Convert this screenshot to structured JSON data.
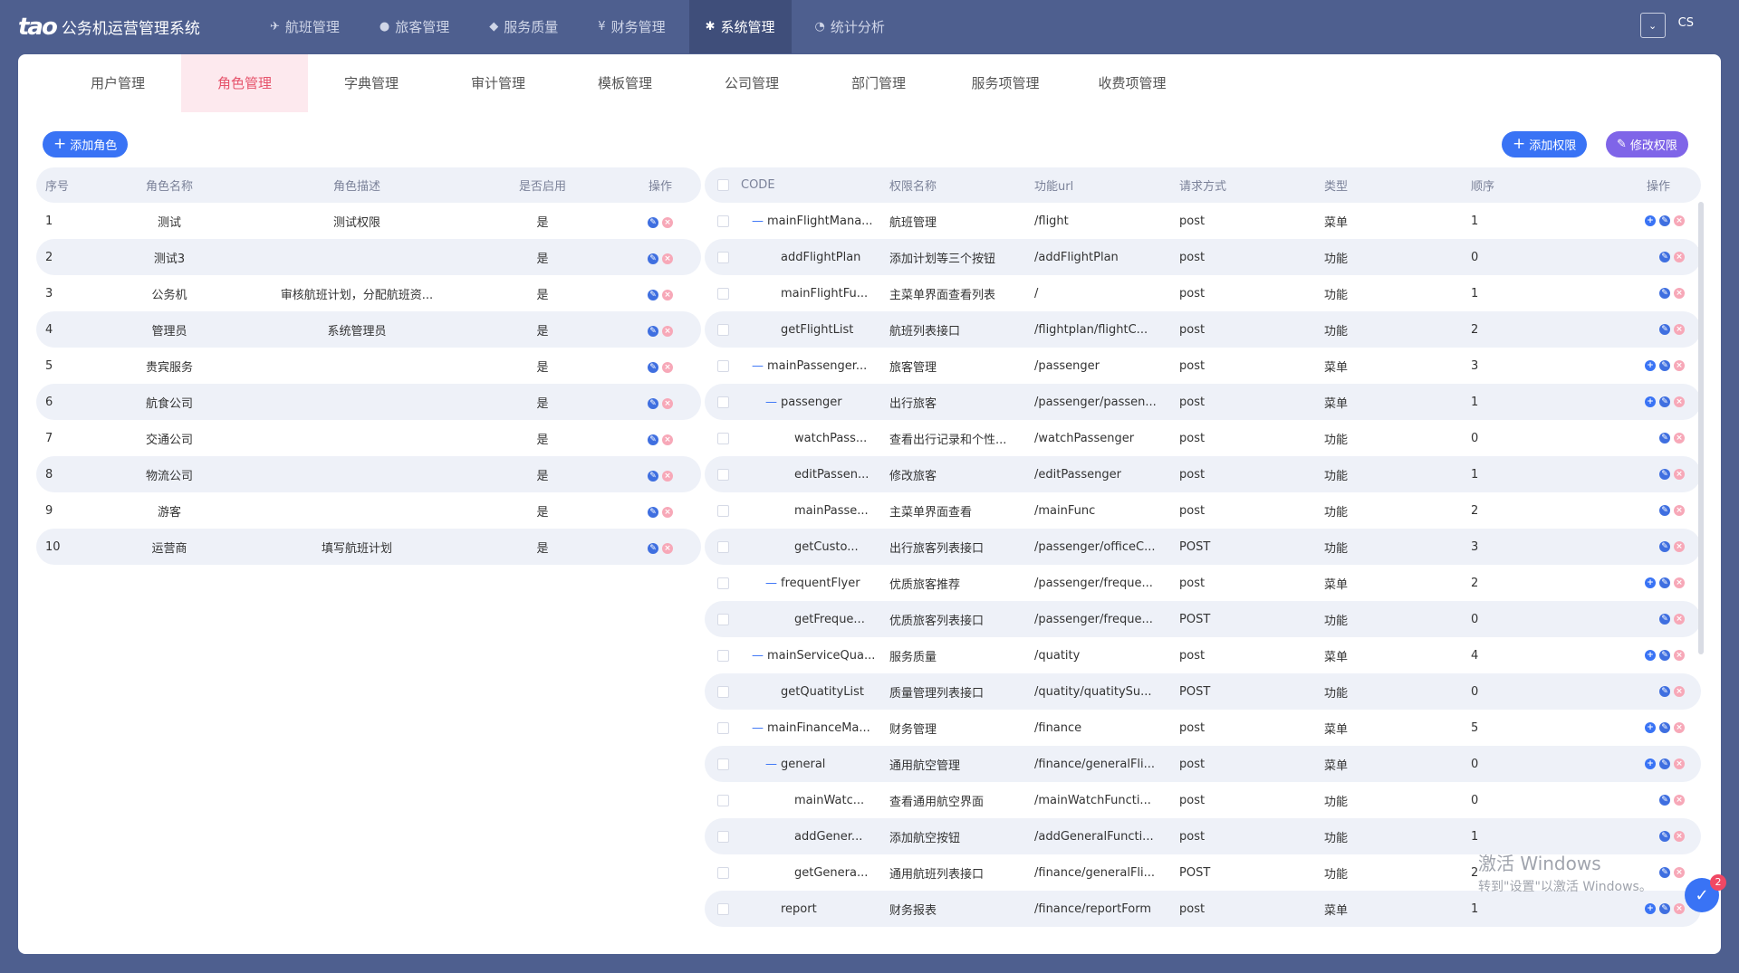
{
  "app": {
    "logo_text": "tao",
    "title": "公务机运营管理系统"
  },
  "nav": [
    {
      "label": "航班管理",
      "icon": "plane-icon"
    },
    {
      "label": "旅客管理",
      "icon": "user-icon"
    },
    {
      "label": "服务质量",
      "icon": "shield-icon"
    },
    {
      "label": "财务管理",
      "icon": "money-icon"
    },
    {
      "label": "系统管理",
      "icon": "gear-icon",
      "active": true
    },
    {
      "label": "统计分析",
      "icon": "pie-chart-icon"
    }
  ],
  "user": {
    "toggle": "⌄",
    "name": "CS"
  },
  "subtabs": [
    {
      "label": "用户管理"
    },
    {
      "label": "角色管理",
      "active": true
    },
    {
      "label": "字典管理"
    },
    {
      "label": "审计管理"
    },
    {
      "label": "模板管理"
    },
    {
      "label": "公司管理"
    },
    {
      "label": "部门管理"
    },
    {
      "label": "服务项管理"
    },
    {
      "label": "收费项管理"
    }
  ],
  "buttons": {
    "add_role": "添加角色",
    "add_perm": "添加权限",
    "edit_perm": "修改权限"
  },
  "roles": {
    "headers": {
      "seq": "序号",
      "name": "角色名称",
      "desc": "角色描述",
      "enabled": "是否启用",
      "op": "操作"
    },
    "rows": [
      {
        "seq": "1",
        "name": "测试",
        "desc": "测试权限",
        "enabled": "是"
      },
      {
        "seq": "2",
        "name": "测试3",
        "desc": "",
        "enabled": "是"
      },
      {
        "seq": "3",
        "name": "公务机",
        "desc": "审核航班计划，分配航班资...",
        "enabled": "是"
      },
      {
        "seq": "4",
        "name": "管理员",
        "desc": "系统管理员",
        "enabled": "是"
      },
      {
        "seq": "5",
        "name": "贵宾服务",
        "desc": "",
        "enabled": "是"
      },
      {
        "seq": "6",
        "name": "航食公司",
        "desc": "",
        "enabled": "是"
      },
      {
        "seq": "7",
        "name": "交通公司",
        "desc": "",
        "enabled": "是"
      },
      {
        "seq": "8",
        "name": "物流公司",
        "desc": "",
        "enabled": "是"
      },
      {
        "seq": "9",
        "name": "游客",
        "desc": "",
        "enabled": "是"
      },
      {
        "seq": "10",
        "name": "运营商",
        "desc": "填写航班计划",
        "enabled": "是"
      }
    ]
  },
  "perms": {
    "headers": {
      "code": "CODE",
      "name": "权限名称",
      "url": "功能url",
      "method": "请求方式",
      "type": "类型",
      "order": "顺序",
      "op": "操作"
    },
    "rows": [
      {
        "level": 0,
        "expander": "—",
        "code": "mainFlightMana...",
        "name": "航班管理",
        "url": "/flight",
        "method": "post",
        "type": "菜单",
        "order": "1",
        "add": true
      },
      {
        "level": 1,
        "expander": "",
        "code": "addFlightPlan",
        "name": "添加计划等三个按钮",
        "url": "/addFlightPlan",
        "method": "post",
        "type": "功能",
        "order": "0",
        "add": false
      },
      {
        "level": 1,
        "expander": "",
        "code": "mainFlightFu...",
        "name": "主菜单界面查看列表",
        "url": "/",
        "method": "post",
        "type": "功能",
        "order": "1",
        "add": false
      },
      {
        "level": 1,
        "expander": "",
        "code": "getFlightList",
        "name": "航班列表接口",
        "url": "/flightplan/flightC...",
        "method": "post",
        "type": "功能",
        "order": "2",
        "add": false
      },
      {
        "level": 0,
        "expander": "—",
        "code": "mainPassenger...",
        "name": "旅客管理",
        "url": "/passenger",
        "method": "post",
        "type": "菜单",
        "order": "3",
        "add": true
      },
      {
        "level": 1,
        "expander": "—",
        "code": "passenger",
        "name": "出行旅客",
        "url": "/passenger/passen...",
        "method": "post",
        "type": "菜单",
        "order": "1",
        "add": true
      },
      {
        "level": 2,
        "expander": "",
        "code": "watchPass...",
        "name": "查看出行记录和个性...",
        "url": "/watchPassenger",
        "method": "post",
        "type": "功能",
        "order": "0",
        "add": false
      },
      {
        "level": 2,
        "expander": "",
        "code": "editPassen...",
        "name": "修改旅客",
        "url": "/editPassenger",
        "method": "post",
        "type": "功能",
        "order": "1",
        "add": false
      },
      {
        "level": 2,
        "expander": "",
        "code": "mainPasse...",
        "name": "主菜单界面查看",
        "url": "/mainFunc",
        "method": "post",
        "type": "功能",
        "order": "2",
        "add": false
      },
      {
        "level": 2,
        "expander": "",
        "code": "getCusto...",
        "name": "出行旅客列表接口",
        "url": "/passenger/officeC...",
        "method": "POST",
        "type": "功能",
        "order": "3",
        "add": false
      },
      {
        "level": 1,
        "expander": "—",
        "code": "frequentFlyer",
        "name": "优质旅客推荐",
        "url": "/passenger/freque...",
        "method": "post",
        "type": "菜单",
        "order": "2",
        "add": true
      },
      {
        "level": 2,
        "expander": "",
        "code": "getFreque...",
        "name": "优质旅客列表接口",
        "url": "/passenger/freque...",
        "method": "POST",
        "type": "功能",
        "order": "0",
        "add": false
      },
      {
        "level": 0,
        "expander": "—",
        "code": "mainServiceQua...",
        "name": "服务质量",
        "url": "/quatity",
        "method": "post",
        "type": "菜单",
        "order": "4",
        "add": true
      },
      {
        "level": 1,
        "expander": "",
        "code": "getQuatityList",
        "name": "质量管理列表接口",
        "url": "/quatity/quatitySu...",
        "method": "POST",
        "type": "功能",
        "order": "0",
        "add": false
      },
      {
        "level": 0,
        "expander": "—",
        "code": "mainFinanceMa...",
        "name": "财务管理",
        "url": "/finance",
        "method": "post",
        "type": "菜单",
        "order": "5",
        "add": true
      },
      {
        "level": 1,
        "expander": "—",
        "code": "general",
        "name": "通用航空管理",
        "url": "/finance/generalFli...",
        "method": "post",
        "type": "菜单",
        "order": "0",
        "add": true
      },
      {
        "level": 2,
        "expander": "",
        "code": "mainWatc...",
        "name": "查看通用航空界面",
        "url": "/mainWatchFuncti...",
        "method": "post",
        "type": "功能",
        "order": "0",
        "add": false
      },
      {
        "level": 2,
        "expander": "",
        "code": "addGener...",
        "name": "添加航空按钮",
        "url": "/addGeneralFuncti...",
        "method": "post",
        "type": "功能",
        "order": "1",
        "add": false
      },
      {
        "level": 2,
        "expander": "",
        "code": "getGenera...",
        "name": "通用航班列表接口",
        "url": "/finance/generalFli...",
        "method": "POST",
        "type": "功能",
        "order": "2",
        "add": false
      },
      {
        "level": 1,
        "expander": "",
        "code": "report",
        "name": "财务报表",
        "url": "/finance/reportForm",
        "method": "post",
        "type": "菜单",
        "order": "1",
        "add": true
      }
    ]
  },
  "watermark": {
    "line1": "激活 Windows",
    "line2": "转到\"设置\"以激活 Windows。"
  },
  "float_badge": {
    "count": "2"
  },
  "colors": {
    "nav_bg": "#4e5f8f",
    "accent": "#3973f5",
    "purple": "#7f65e8",
    "active_tab": "#e6536b",
    "row_alt": "#eef1f8"
  }
}
